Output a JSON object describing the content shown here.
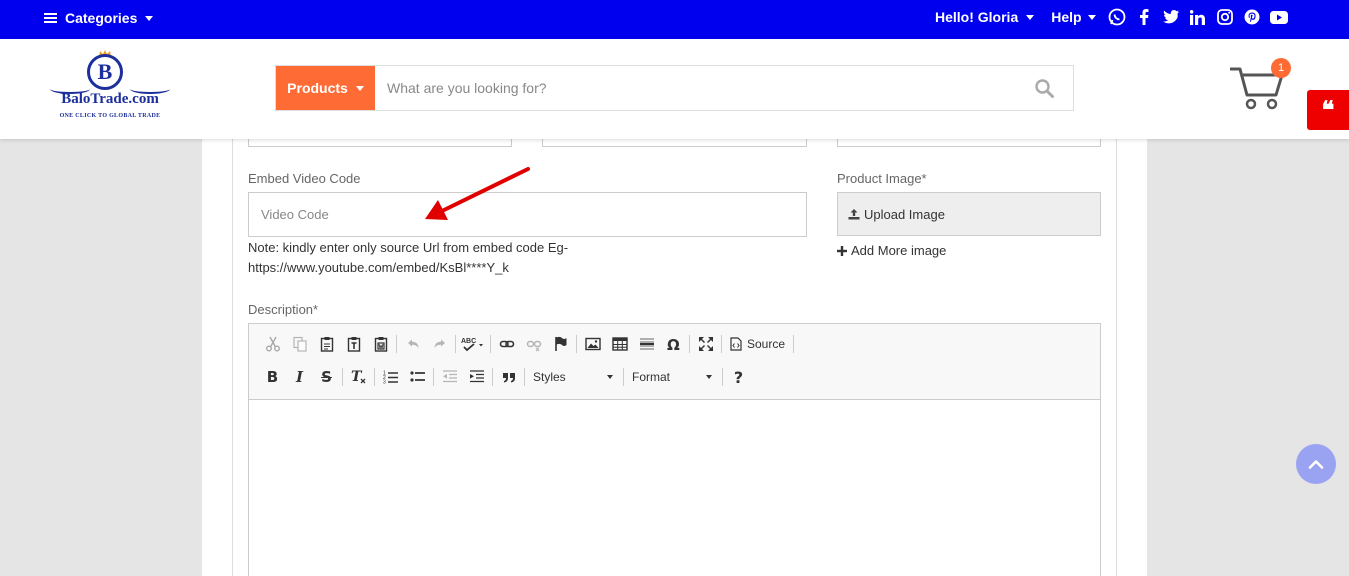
{
  "topbar": {
    "categories_label": "Categories",
    "greeting": "Hello! Gloria",
    "help_label": "Help",
    "social_icons": [
      "whatsapp-icon",
      "facebook-icon",
      "twitter-icon",
      "linkedin-icon",
      "instagram-icon",
      "pinterest-icon",
      "youtube-icon"
    ]
  },
  "header": {
    "logo_letter": "B",
    "logo_name": "BaloTrade.com",
    "logo_tagline": "ONE CLICK TO GLOBAL TRADE",
    "search": {
      "category_label": "Products",
      "placeholder": "What are you looking for?"
    },
    "cart_count": "1"
  },
  "form": {
    "video_label": "Embed Video Code",
    "video_placeholder": "Video Code",
    "video_note": "Note: kindly enter only source Url from embed code Eg- https://www.youtube.com/embed/KsBl****Y_k",
    "image_label": "Product Image*",
    "upload_label": "Upload Image",
    "add_more_label": "Add More image",
    "description_label": "Description*"
  },
  "editor": {
    "source_label": "Source",
    "styles_label": "Styles",
    "format_label": "Format"
  },
  "colors": {
    "topbar": "#0000ee",
    "accent": "#ff6b35",
    "quote_tab": "#ee0000",
    "annotation_arrow": "#e00000",
    "scroll_button": "#9aa2f2"
  }
}
